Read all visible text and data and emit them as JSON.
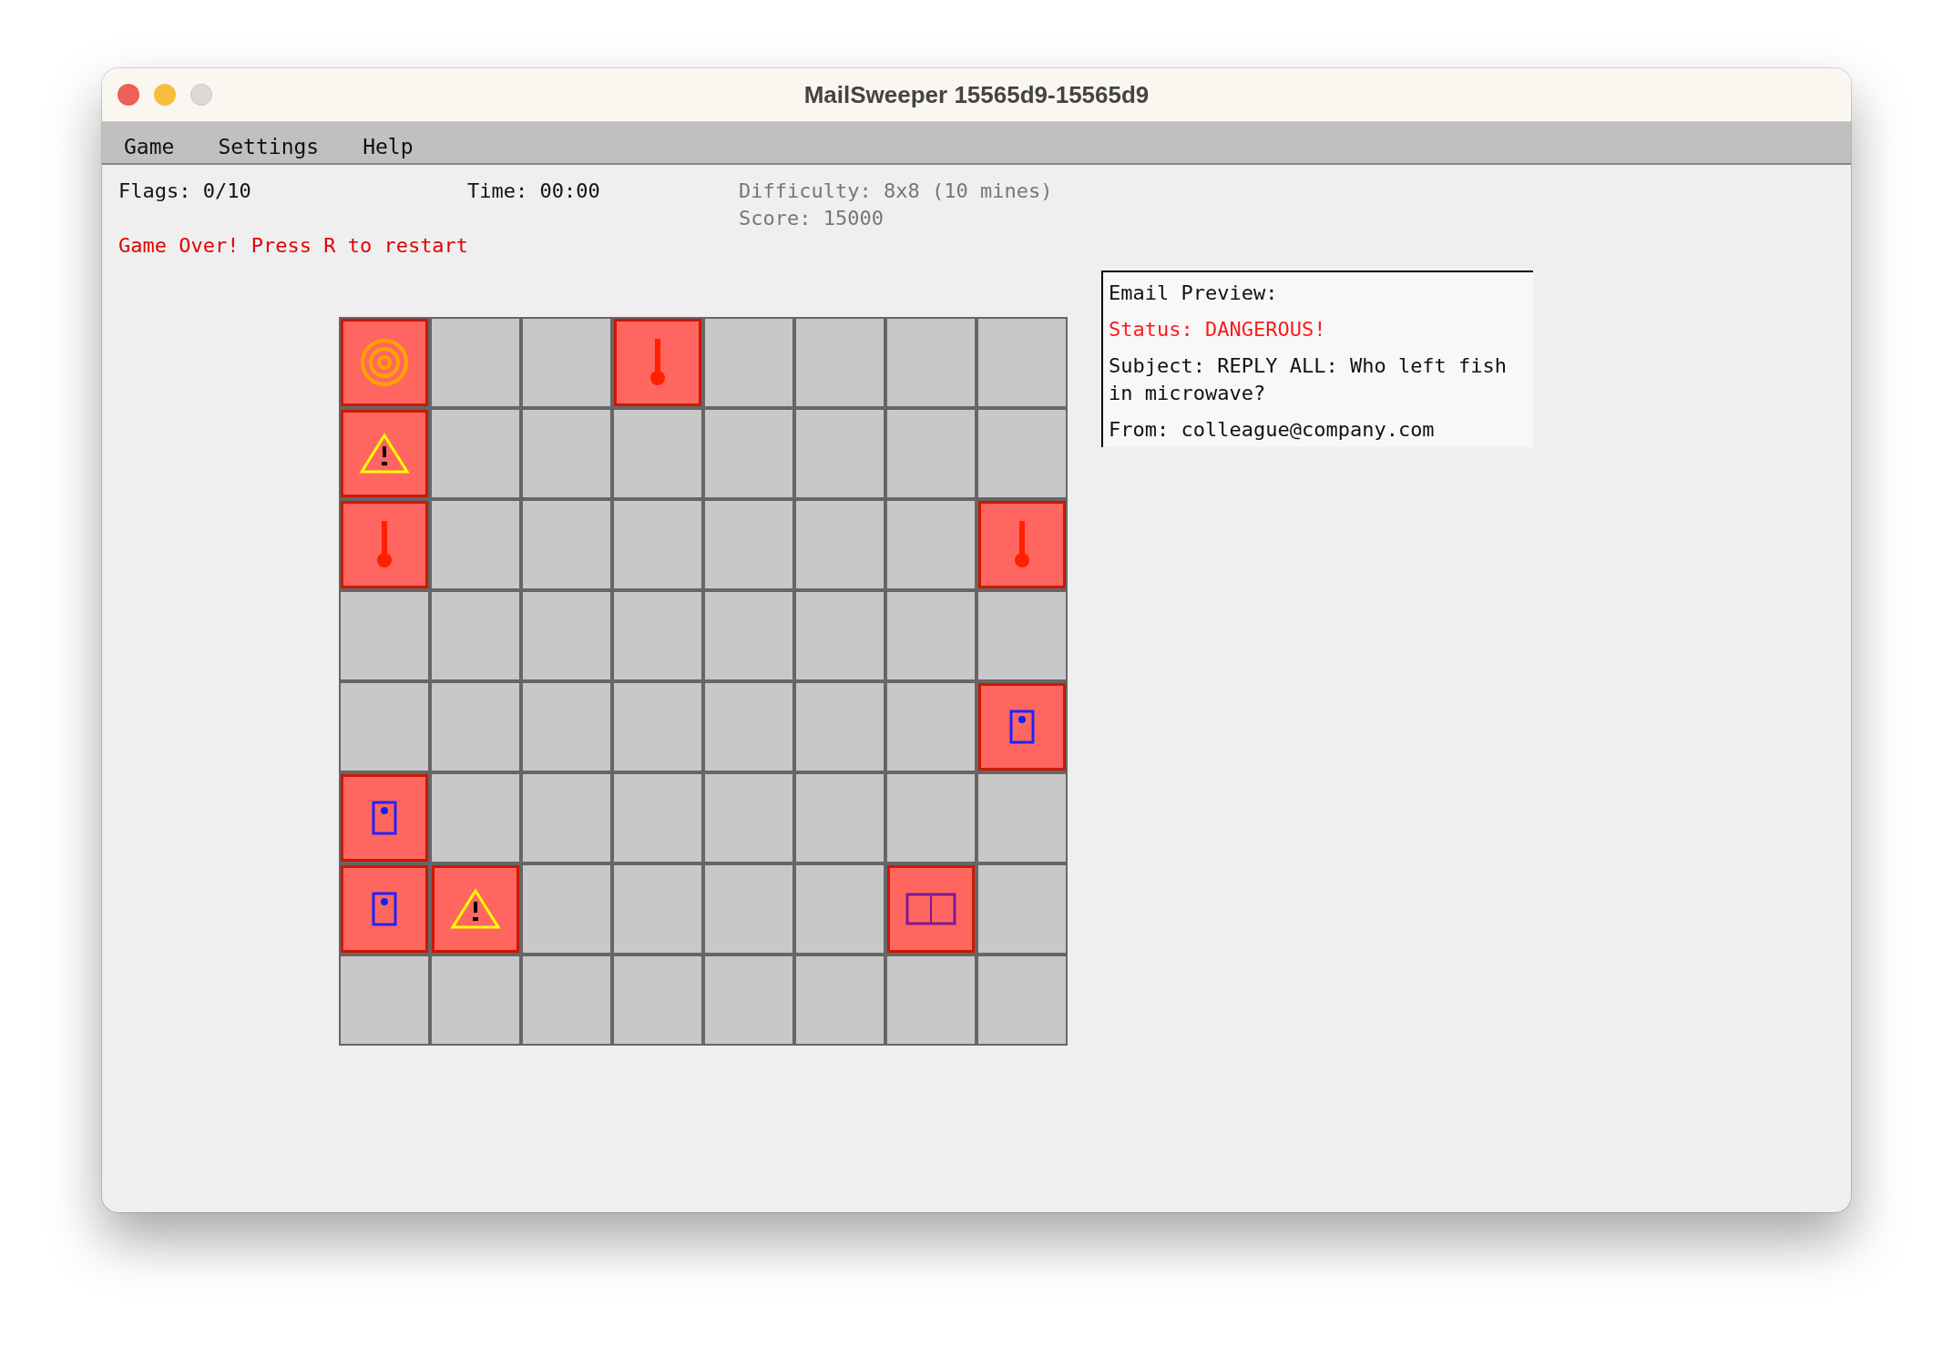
{
  "window": {
    "title": "MailSweeper 15565d9-15565d9"
  },
  "menu": [
    "Game",
    "Settings",
    "Help"
  ],
  "stats": {
    "flags": "Flags: 0/10",
    "time": "Time: 00:00",
    "difficulty": "Difficulty: 8x8 (10 mines)",
    "score": "Score: 15000"
  },
  "message": "Game Over! Press R to restart",
  "board": [
    [
      {
        "kind": "target"
      },
      {
        "kind": "hidden"
      },
      {
        "kind": "hidden"
      },
      {
        "kind": "pin"
      },
      {
        "kind": "hidden"
      },
      {
        "kind": "hidden"
      },
      {
        "kind": "hidden"
      },
      {
        "kind": "hidden"
      }
    ],
    [
      {
        "kind": "warning"
      },
      {
        "kind": "hidden"
      },
      {
        "kind": "hidden"
      },
      {
        "kind": "hidden"
      },
      {
        "kind": "hidden"
      },
      {
        "kind": "hidden"
      },
      {
        "kind": "hidden"
      },
      {
        "kind": "hidden"
      }
    ],
    [
      {
        "kind": "pin"
      },
      {
        "kind": "hidden"
      },
      {
        "kind": "hidden"
      },
      {
        "kind": "hidden"
      },
      {
        "kind": "hidden"
      },
      {
        "kind": "hidden"
      },
      {
        "kind": "hidden"
      },
      {
        "kind": "pin"
      }
    ],
    [
      {
        "kind": "hidden"
      },
      {
        "kind": "hidden"
      },
      {
        "kind": "hidden"
      },
      {
        "kind": "hidden"
      },
      {
        "kind": "hidden"
      },
      {
        "kind": "hidden"
      },
      {
        "kind": "hidden"
      },
      {
        "kind": "hidden"
      }
    ],
    [
      {
        "kind": "hidden"
      },
      {
        "kind": "hidden"
      },
      {
        "kind": "hidden"
      },
      {
        "kind": "hidden"
      },
      {
        "kind": "hidden"
      },
      {
        "kind": "hidden"
      },
      {
        "kind": "hidden"
      },
      {
        "kind": "door"
      }
    ],
    [
      {
        "kind": "door"
      },
      {
        "kind": "hidden"
      },
      {
        "kind": "hidden"
      },
      {
        "kind": "hidden"
      },
      {
        "kind": "hidden"
      },
      {
        "kind": "hidden"
      },
      {
        "kind": "hidden"
      },
      {
        "kind": "hidden"
      }
    ],
    [
      {
        "kind": "door"
      },
      {
        "kind": "warning"
      },
      {
        "kind": "hidden"
      },
      {
        "kind": "hidden"
      },
      {
        "kind": "hidden"
      },
      {
        "kind": "hidden"
      },
      {
        "kind": "panel"
      },
      {
        "kind": "hidden"
      }
    ],
    [
      {
        "kind": "hidden"
      },
      {
        "kind": "hidden"
      },
      {
        "kind": "hidden"
      },
      {
        "kind": "hidden"
      },
      {
        "kind": "hidden"
      },
      {
        "kind": "hidden"
      },
      {
        "kind": "hidden"
      },
      {
        "kind": "hidden"
      }
    ]
  ],
  "email_preview": {
    "heading": "Email Preview:",
    "status": "Status: DANGEROUS!",
    "subject": "Subject: REPLY ALL: Who left fish in microwave?",
    "from": "From: colleague@company.com"
  }
}
